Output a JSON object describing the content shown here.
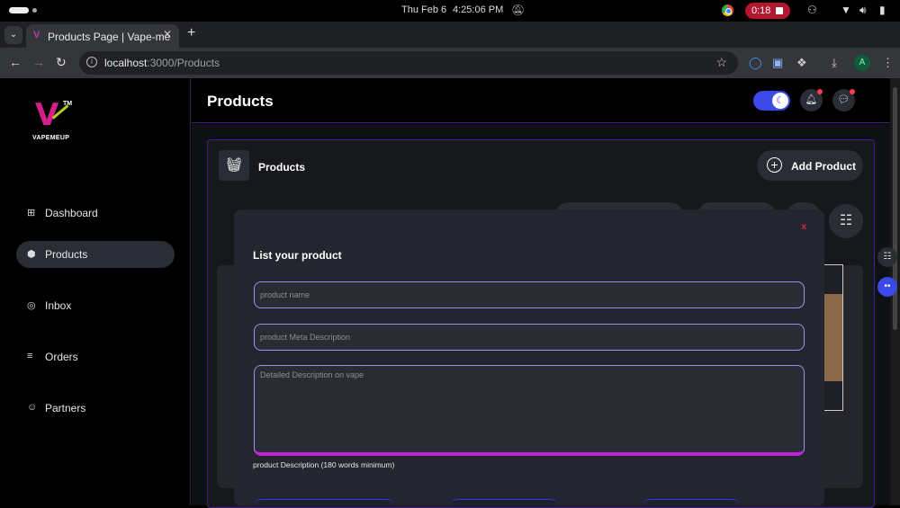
{
  "os": {
    "date": "Thu Feb 6",
    "time": "4:25:06 PM",
    "recording": "0:18",
    "icons": [
      "notifications-off-icon",
      "accessibility-icon",
      "wifi-icon",
      "volume-icon",
      "battery-icon"
    ]
  },
  "browser": {
    "tab_title": "Products Page | Vape-me",
    "url_host": "localhost",
    "url_rest": ":3000/Products",
    "profile_initial": "A"
  },
  "sidebar": {
    "brand": "VAPEMEUP",
    "tm": "TM",
    "logo_letter": "V",
    "items": [
      {
        "label": "Dashboard",
        "icon": "dashboard-icon"
      },
      {
        "label": "Products",
        "icon": "products-icon",
        "active": true
      },
      {
        "label": "Inbox",
        "icon": "inbox-icon"
      },
      {
        "label": "Orders",
        "icon": "orders-icon"
      },
      {
        "label": "Partners",
        "icon": "partners-icon"
      }
    ]
  },
  "header": {
    "title": "Products"
  },
  "panel": {
    "title": "Products",
    "add_button": "Add Product"
  },
  "modal": {
    "close": "x",
    "title": "List your product",
    "product_name_placeholder": "product name",
    "meta_description_placeholder": "product Meta Description",
    "detailed_description_placeholder": "Detailed Description on vape",
    "helper": "product Description (180 words minimum)"
  },
  "colors": {
    "accent_purple": "#4b1d8f",
    "toggle_blue": "#3a49e8",
    "field_border": "#a38cf0",
    "close_red": "#e0263d",
    "brand_pink": "#d21f8a"
  }
}
